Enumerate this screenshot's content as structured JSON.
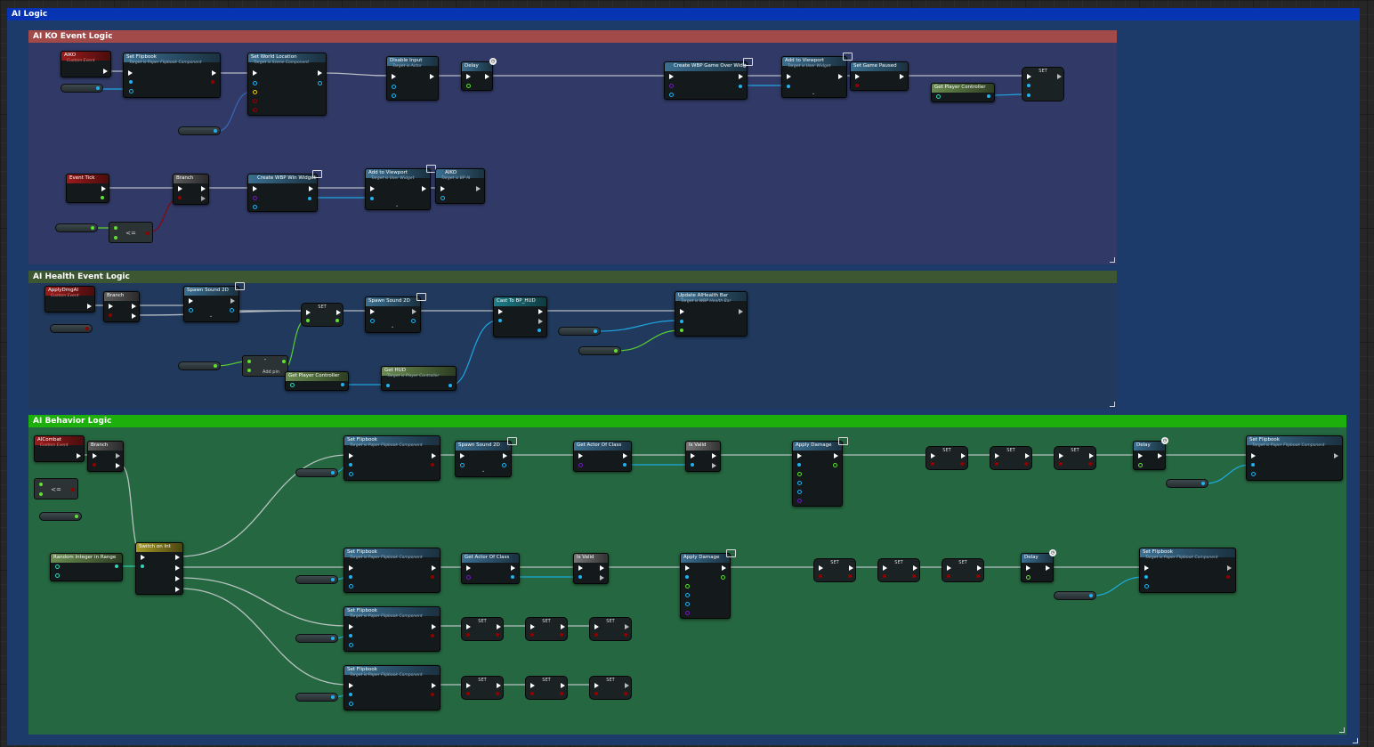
{
  "comments": {
    "outer": "AI Logic",
    "ko": "AI KO Event Logic",
    "health": "AI Health Event Logic",
    "behavior": "AI Behavior Logic"
  },
  "colors": {
    "outer_header": "#0734b3",
    "ko_header": "#a24949",
    "health_header": "#3d5732",
    "behavior_header": "#1db00c",
    "exec_pin": "#ffffff",
    "object_pin": "#1eb2f0",
    "bool_pin": "#930000",
    "float_pin": "#5ee02e",
    "int_pin": "#33d7b6",
    "vector_pin": "#f4cc10",
    "byte_pin": "#6b1cb5"
  },
  "ko_nodes": {
    "aiko_event": {
      "title": "AIKO",
      "sub": "Custom Event"
    },
    "set_flipbook": {
      "title": "Set Flipbook",
      "sub": "Target is Paper Flipbook Component"
    },
    "set_world_location": {
      "title": "Set World Location",
      "sub": "Target is Scene Component"
    },
    "disable_input": {
      "title": "Disable Input",
      "sub": "Target is Actor"
    },
    "delay": {
      "title": "Delay"
    },
    "create_game_over": {
      "title": "Create WBP Game Over Widget"
    },
    "add_to_viewport": {
      "title": "Add to Viewport",
      "sub": "Target is User Widget"
    },
    "set_game_paused": {
      "title": "Set Game Paused"
    },
    "get_player_controller": {
      "title": "Get Player Controller"
    },
    "set_node": {
      "title": "SET"
    },
    "event_tick": {
      "title": "Event Tick"
    },
    "branch": {
      "title": "Branch"
    },
    "create_win": {
      "title": "Create WBP Win Widget"
    },
    "add_to_viewport_2": {
      "title": "Add to Viewport",
      "sub": "Target is User Widget"
    },
    "aiko_call": {
      "title": "AIKO",
      "sub": "Target is BP AI"
    },
    "compare": {
      "symbol": "<="
    }
  },
  "health_nodes": {
    "apply_dmg_event": {
      "title": "ApplyDmgAI",
      "sub": "Custom Event"
    },
    "branch": {
      "title": "Branch"
    },
    "spawn_sound": {
      "title": "Spawn Sound 2D"
    },
    "set_node": {
      "title": "SET"
    },
    "spawn_sound_2": {
      "title": "Spawn Sound 2D"
    },
    "cast_hud": {
      "title": "Cast To BP_HUD"
    },
    "update_health": {
      "title": "Update AIHealth Bar",
      "sub": "Target is WBP Health Bar"
    },
    "subtract": {
      "symbol": "-",
      "add_pin": "Add pin"
    },
    "get_player_controller": {
      "title": "Get Player Controller"
    },
    "get_hud": {
      "title": "Get HUD",
      "sub": "Target is Player Controller"
    }
  },
  "behavior_nodes": {
    "aicombat_event": {
      "title": "AICombat",
      "sub": "Custom Event"
    },
    "branch": {
      "title": "Branch"
    },
    "compare": {
      "symbol": "<="
    },
    "random_int": {
      "title": "Random Integer in Range"
    },
    "switch_int": {
      "title": "Switch on Int"
    },
    "set_flipbook": {
      "title": "Set Flipbook",
      "sub": "Target is Paper Flipbook Component"
    },
    "spawn_sound": {
      "title": "Spawn Sound 2D"
    },
    "get_actor_of_class": {
      "title": "Get Actor Of Class"
    },
    "is_valid": {
      "title": "Is Valid"
    },
    "apply_damage": {
      "title": "Apply Damage"
    },
    "set_label": "SET",
    "delay": {
      "title": "Delay"
    }
  }
}
